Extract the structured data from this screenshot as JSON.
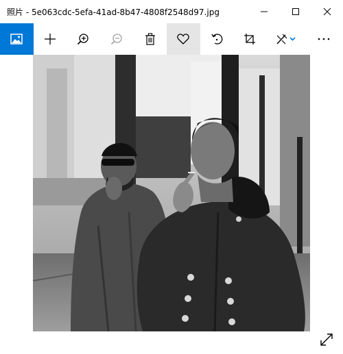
{
  "window": {
    "title": "照片 - 5e063cdc-5efa-41ad-8b47-4808f2548d97.jpg"
  },
  "titlebar_buttons": [
    {
      "name": "minimize-button",
      "icon": "minimize-icon"
    },
    {
      "name": "maximize-button",
      "icon": "maximize-icon"
    },
    {
      "name": "close-button",
      "icon": "close-icon"
    }
  ],
  "toolbar": {
    "items": [
      {
        "name": "see-all-photos-button",
        "icon": "photo-icon",
        "state": "active"
      },
      {
        "name": "add-to-button",
        "icon": "plus-icon"
      },
      {
        "name": "zoom-in-button",
        "icon": "zoom-in-icon"
      },
      {
        "name": "zoom-out-button",
        "icon": "zoom-out-icon",
        "state": "disabled"
      },
      {
        "name": "delete-button",
        "icon": "trash-icon"
      },
      {
        "name": "favorite-button",
        "icon": "heart-icon",
        "state": "hover"
      },
      {
        "name": "rotate-button",
        "icon": "rotate-icon"
      },
      {
        "name": "crop-button",
        "icon": "crop-icon"
      },
      {
        "name": "edit-create-button",
        "icon": "edit-icon"
      },
      {
        "name": "more-button",
        "icon": "more-icon"
      }
    ],
    "accent_color": "#0078d7",
    "hover_color": "#e5e5e5"
  },
  "photo": {
    "description_icon": "photo-content",
    "style": "black-and-white"
  },
  "fullscreen": {
    "icon": "expand-icon"
  }
}
